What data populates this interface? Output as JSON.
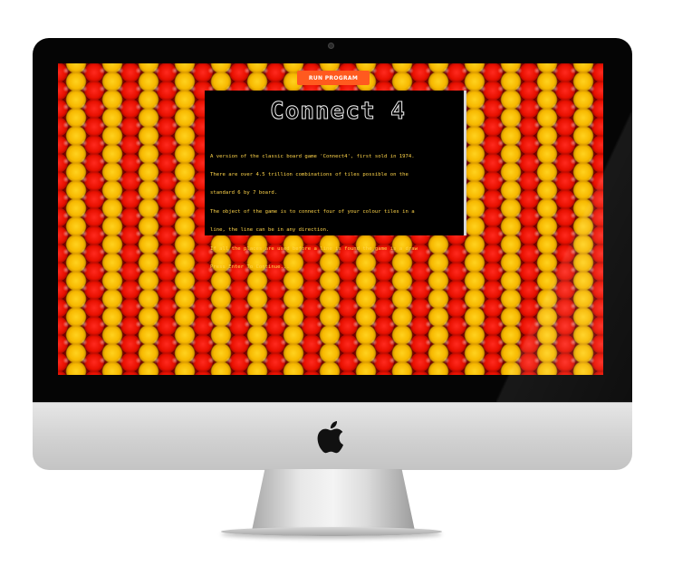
{
  "toolbar": {
    "run_label": "RUN PROGRAM"
  },
  "terminal": {
    "title": "Connect 4",
    "lines": [
      "A version of the classic board game 'Connect4', first sold in 1974.",
      "There are over 4.5 trillion combinations of tiles possible on the",
      "standard 6 by 7 board.",
      "The object of the game is to connect four of your colour tiles in a",
      "line, the line can be in any direction.",
      "If all the places are used before a line is found the game is a draw",
      "Press Enter To Continue..."
    ]
  },
  "colors": {
    "red_piece": "#e81000",
    "yellow_piece": "#f7b900",
    "run_button": "#ff5a1f",
    "terminal_text": "#ffd54a"
  },
  "icons": {
    "apple_logo": "apple-logo"
  }
}
